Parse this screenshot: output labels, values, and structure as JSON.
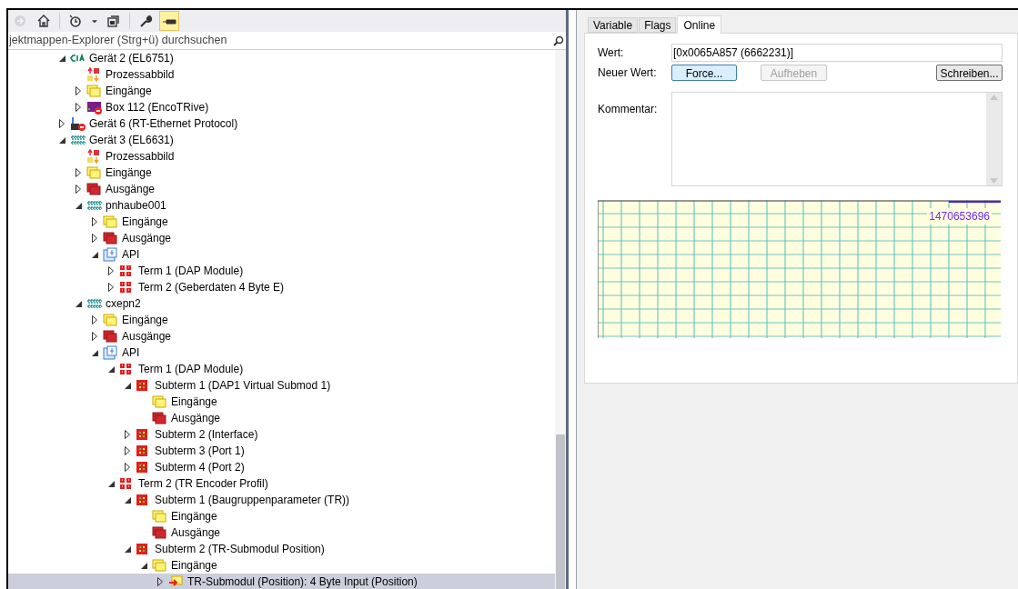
{
  "toolbar": {
    "buttons": [
      {
        "kind": "back",
        "disabled": true
      },
      {
        "kind": "home"
      },
      {
        "kind": "history"
      },
      {
        "kind": "dropdown"
      },
      {
        "kind": "windows"
      },
      {
        "kind": "wrench"
      },
      {
        "kind": "pin",
        "on": true
      }
    ]
  },
  "search": {
    "placeholder": "jektmappen-Explorer (Strg+ü) durchsuchen"
  },
  "tree": [
    {
      "label": "Gerät 2 (EL6751)",
      "kind": "cia",
      "expanded": true,
      "selected": false,
      "children": [
        {
          "label": "Prozessabbild",
          "kind": "process-image",
          "selected": false
        },
        {
          "label": "Eingänge",
          "kind": "inputs",
          "expanded": false,
          "selected": false
        },
        {
          "label": "Box 112 (EncoTRive)",
          "kind": "box",
          "expanded": false,
          "selected": false
        }
      ]
    },
    {
      "label": "Gerät 6 (RT-Ethernet Protocol)",
      "kind": "ethernet",
      "expanded": false,
      "selected": false
    },
    {
      "label": "Gerät 3 (EL6631)",
      "kind": "profinet",
      "expanded": true,
      "selected": false,
      "children": [
        {
          "label": "Prozessabbild",
          "kind": "process-image",
          "selected": false
        },
        {
          "label": "Eingänge",
          "kind": "inputs",
          "expanded": false,
          "selected": false
        },
        {
          "label": "Ausgänge",
          "kind": "outputs",
          "expanded": false,
          "selected": false
        },
        {
          "label": "pnhaube001",
          "kind": "profinet",
          "expanded": true,
          "selected": false,
          "children": [
            {
              "label": "Eingänge",
              "kind": "inputs",
              "expanded": false,
              "selected": false
            },
            {
              "label": "Ausgänge",
              "kind": "outputs",
              "expanded": false,
              "selected": false
            },
            {
              "label": "API",
              "kind": "api",
              "expanded": true,
              "selected": false,
              "children": [
                {
                  "label": "Term 1 (DAP Module)",
                  "kind": "term",
                  "expanded": false,
                  "selected": false
                },
                {
                  "label": "Term 2 (Geberdaten 4 Byte E)",
                  "kind": "term",
                  "expanded": false,
                  "selected": false
                }
              ]
            }
          ]
        },
        {
          "label": "cxepn2",
          "kind": "profinet",
          "expanded": true,
          "selected": false,
          "children": [
            {
              "label": "Eingänge",
              "kind": "inputs",
              "expanded": false,
              "selected": false
            },
            {
              "label": "Ausgänge",
              "kind": "outputs",
              "expanded": false,
              "selected": false
            },
            {
              "label": "API",
              "kind": "api",
              "expanded": true,
              "selected": false,
              "children": [
                {
                  "label": "Term 1 (DAP Module)",
                  "kind": "term",
                  "expanded": true,
                  "selected": false,
                  "children": [
                    {
                      "label": "Subterm 1 (DAP1 Virtual Submod 1)",
                      "kind": "subterm",
                      "expanded": true,
                      "selected": false,
                      "children": [
                        {
                          "label": "Eingänge",
                          "kind": "inputs",
                          "selected": false
                        },
                        {
                          "label": "Ausgänge",
                          "kind": "outputs",
                          "selected": false
                        }
                      ]
                    },
                    {
                      "label": "Subterm 2 (Interface)",
                      "kind": "subterm",
                      "expanded": false,
                      "selected": false
                    },
                    {
                      "label": "Subterm 3 (Port 1)",
                      "kind": "subterm",
                      "expanded": false,
                      "selected": false
                    },
                    {
                      "label": "Subterm 4 (Port 2)",
                      "kind": "subterm",
                      "expanded": false,
                      "selected": false
                    }
                  ]
                },
                {
                  "label": "Term 2 (TR Encoder Profil)",
                  "kind": "term",
                  "expanded": true,
                  "selected": false,
                  "children": [
                    {
                      "label": "Subterm 1 (Baugruppenparameter (TR))",
                      "kind": "subterm",
                      "expanded": true,
                      "selected": false,
                      "children": [
                        {
                          "label": "Eingänge",
                          "kind": "inputs",
                          "selected": false
                        },
                        {
                          "label": "Ausgänge",
                          "kind": "outputs",
                          "selected": false
                        }
                      ]
                    },
                    {
                      "label": "Subterm 2 (TR-Submodul Position)",
                      "kind": "subterm",
                      "expanded": true,
                      "selected": false,
                      "children": [
                        {
                          "label": "Eingänge",
                          "kind": "inputs",
                          "expanded": true,
                          "selected": false,
                          "children": [
                            {
                              "label": "TR-Submodul (Position): 4 Byte Input (Position)",
                              "kind": "variable",
                              "expanded": false,
                              "selected": true
                            }
                          ]
                        }
                      ]
                    }
                  ]
                }
              ]
            }
          ]
        }
      ]
    }
  ],
  "tabs": [
    {
      "label": "Variable",
      "selected": false
    },
    {
      "label": "Flags",
      "selected": false
    },
    {
      "label": "Online",
      "selected": true
    }
  ],
  "online": {
    "value_label": "Wert:",
    "value": "[0x0065A857 (6662231)]",
    "new_value_label": "Neuer Wert:",
    "buttons": [
      {
        "label": "Force...",
        "kind": "default",
        "disabled": false
      },
      {
        "label": "Aufheben",
        "disabled": true
      },
      {
        "label": "Schreiben...",
        "kind": "normal",
        "disabled": false
      }
    ],
    "comment_label": "Kommentar:",
    "graph_reading": "1470653696"
  }
}
